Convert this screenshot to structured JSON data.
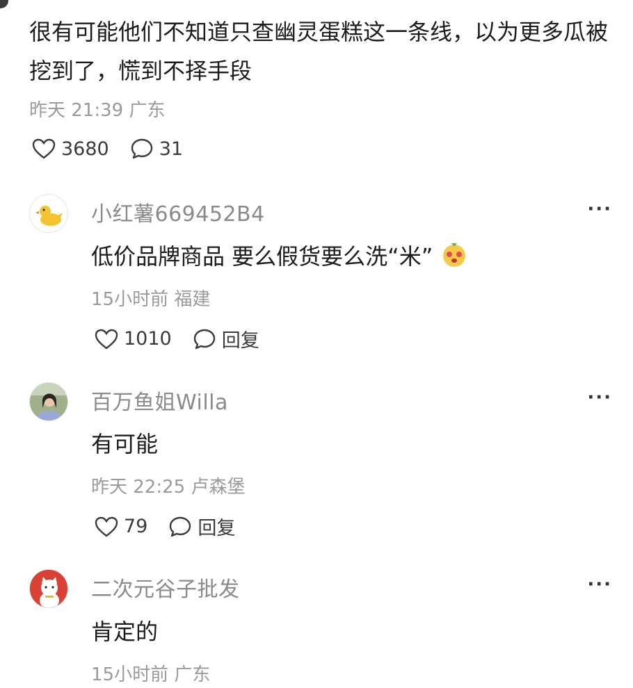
{
  "main_comment": {
    "text": "很有可能他们不知道只查幽灵蛋糕这一条线，以为更多瓜被挖到了，慌到不择手段",
    "time": "昨天 21:39",
    "location": "广东",
    "likes": "3680",
    "replies": "31"
  },
  "replies": [
    {
      "username": "小红薯669452B4",
      "text": "低价品牌商品 要么假货要么洗“米”",
      "time": "15小时前",
      "location": "福建",
      "likes": "1010",
      "reply_label": "回复",
      "avatar_icon": "duck-avatar",
      "emoji_icon": "face-emoji"
    },
    {
      "username": "百万鱼姐Willa",
      "text": "有可能",
      "time": "昨天 22:25",
      "location": "卢森堡",
      "likes": "79",
      "reply_label": "回复",
      "avatar_icon": "photo-avatar"
    },
    {
      "username": "二次元谷子批发",
      "text": "肯定的",
      "time": "15小时前",
      "location": "广东",
      "avatar_icon": "lucky-cat-avatar"
    }
  ],
  "more_label": "···"
}
